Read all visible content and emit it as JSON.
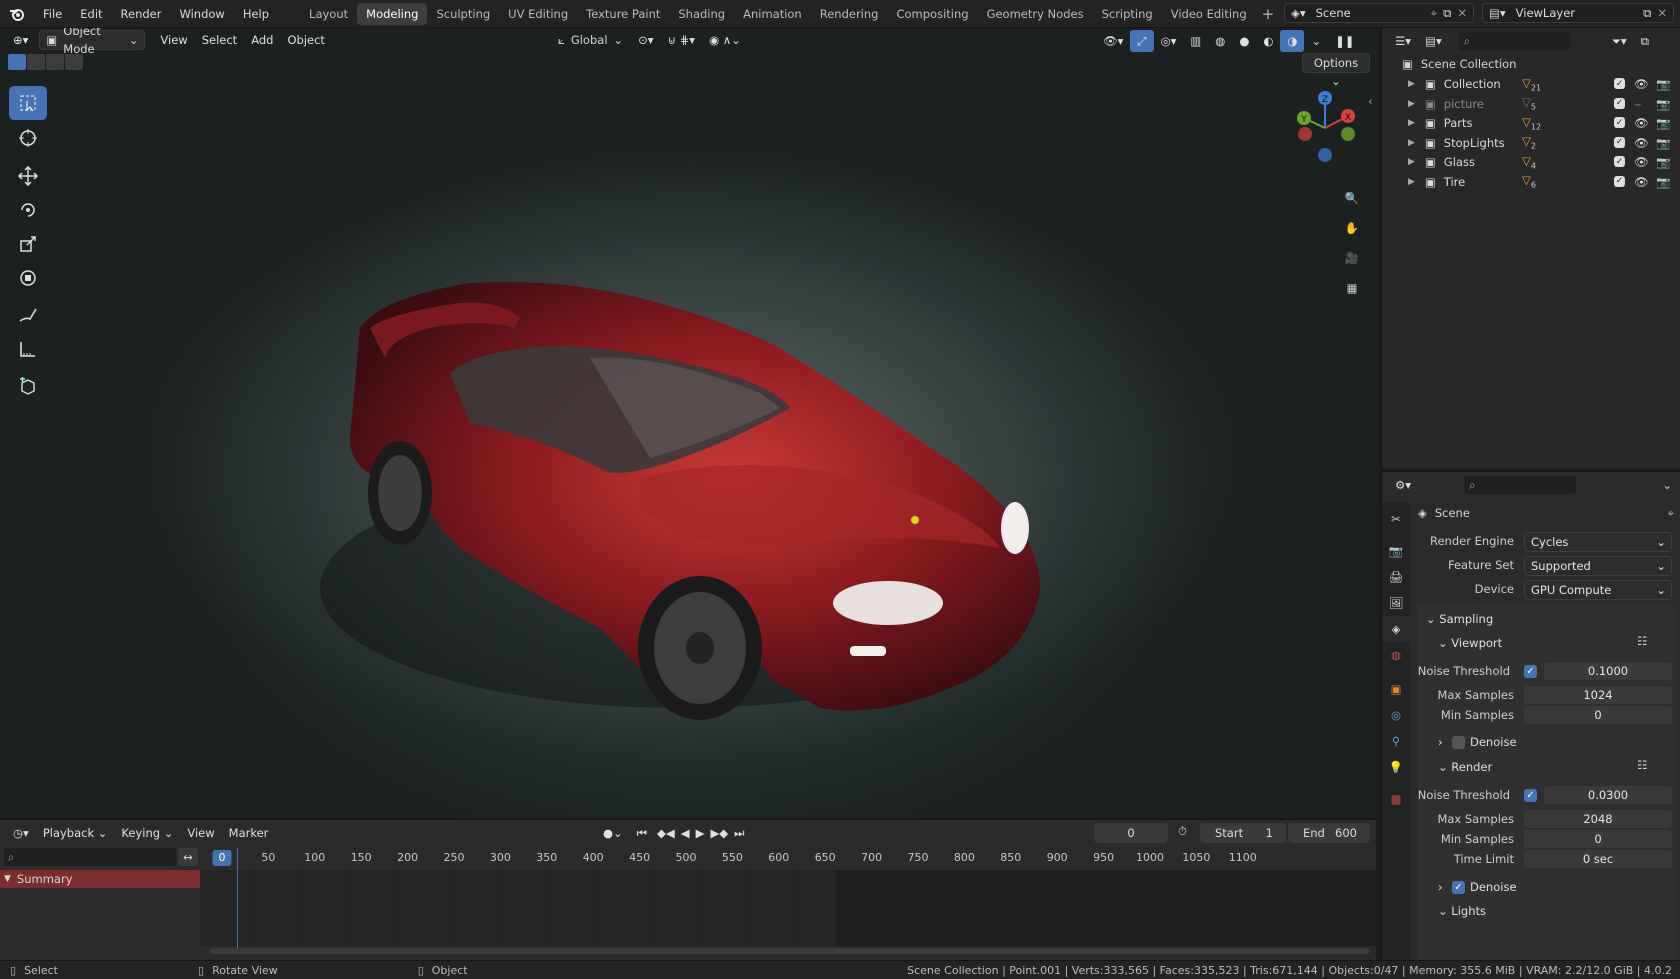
{
  "menu": {
    "file": "File",
    "edit": "Edit",
    "render": "Render",
    "window": "Window",
    "help": "Help"
  },
  "workspaces": [
    "Layout",
    "Modeling",
    "Sculpting",
    "UV Editing",
    "Texture Paint",
    "Shading",
    "Animation",
    "Rendering",
    "Compositing",
    "Geometry Nodes",
    "Scripting",
    "Video Editing"
  ],
  "active_workspace": "Modeling",
  "scene_name": "Scene",
  "view_layer": "ViewLayer",
  "viewport": {
    "mode": "Object Mode",
    "menus": [
      "View",
      "Select",
      "Add",
      "Object"
    ],
    "orientation": "Global",
    "options": "Options",
    "gizmo": {
      "x": "X",
      "y": "Y",
      "z": "Z"
    }
  },
  "outliner": {
    "root": "Scene Collection",
    "items": [
      {
        "name": "Collection",
        "badge": "21",
        "dim": false
      },
      {
        "name": "picture",
        "badge": "5",
        "dim": true
      },
      {
        "name": "Parts",
        "badge": "12",
        "dim": false
      },
      {
        "name": "StopLights",
        "badge": "2",
        "dim": false
      },
      {
        "name": "Glass",
        "badge": "4",
        "dim": false
      },
      {
        "name": "Tire",
        "badge": "6",
        "dim": false
      }
    ]
  },
  "properties": {
    "context": "Scene",
    "render_engine": {
      "label": "Render Engine",
      "value": "Cycles"
    },
    "feature_set": {
      "label": "Feature Set",
      "value": "Supported"
    },
    "device": {
      "label": "Device",
      "value": "GPU Compute"
    },
    "sampling": "Sampling",
    "viewport": {
      "title": "Viewport",
      "noise_label": "Noise Threshold",
      "noise": "0.1000",
      "max_label": "Max Samples",
      "max": "1024",
      "min_label": "Min Samples",
      "min": "0",
      "denoise": "Denoise"
    },
    "render": {
      "title": "Render",
      "noise_label": "Noise Threshold",
      "noise": "0.0300",
      "max_label": "Max Samples",
      "max": "2048",
      "min_label": "Min Samples",
      "min": "0",
      "time_label": "Time Limit",
      "time": "0 sec",
      "denoise": "Denoise"
    },
    "lights": "Lights"
  },
  "timeline": {
    "menus": [
      "Playback",
      "Keying",
      "View",
      "Marker"
    ],
    "current_frame": "0",
    "start_label": "Start",
    "start": "1",
    "end_label": "End",
    "end": "600",
    "summary": "Summary",
    "ticks": [
      "0",
      "50",
      "100",
      "150",
      "200",
      "250",
      "300",
      "350",
      "400",
      "450",
      "500",
      "550",
      "600",
      "650",
      "700",
      "750",
      "800",
      "850",
      "900",
      "950",
      "1000",
      "1050",
      "1100"
    ]
  },
  "status": {
    "select": "Select",
    "rotate": "Rotate View",
    "object": "Object",
    "info": "Scene Collection | Point.001 | Verts:333,565 | Faces:335,523 | Tris:671,144 | Objects:0/47 | Memory: 355.6 MiB | VRAM: 2.2/12.0 GiB | 4.0.2"
  },
  "colors": {
    "accent": "#4772b3",
    "header": "#232323",
    "panel": "#2b2b2b",
    "car": "#8e1c22"
  }
}
